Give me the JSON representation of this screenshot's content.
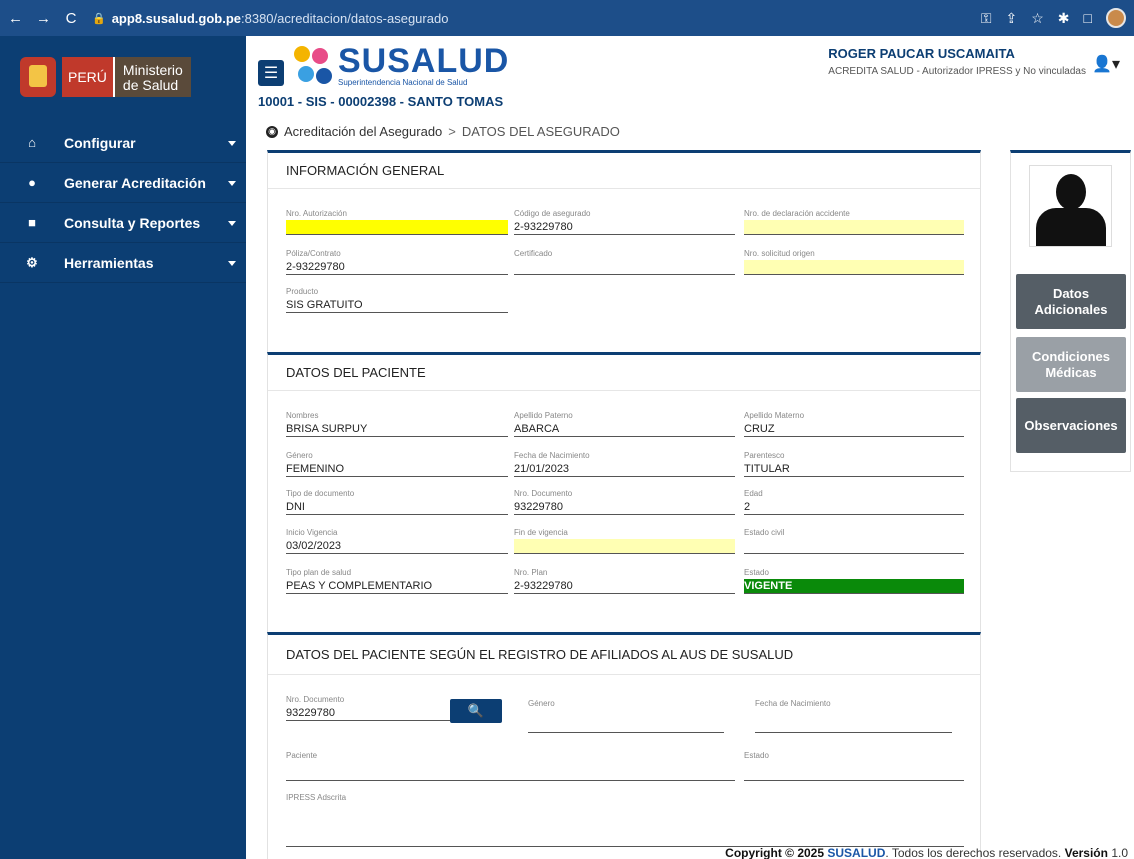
{
  "browser": {
    "url_domain": "app8.susalud.gob.pe",
    "url_path": ":8380/acreditacion/datos-asegurado"
  },
  "sidebar": {
    "logo_peru": "PERÚ",
    "logo_min_1": "Ministerio",
    "logo_min_2": "de Salud",
    "items": [
      {
        "label": "Configurar",
        "icon": "home-icon"
      },
      {
        "label": "Generar Acreditación",
        "icon": "user-icon"
      },
      {
        "label": "Consulta y Reportes",
        "icon": "report-icon"
      },
      {
        "label": "Herramientas",
        "icon": "gears-icon"
      }
    ]
  },
  "header": {
    "brand": "SUSALUD",
    "brand_sub": "Superintendencia Nacional de Salud",
    "ipress": "10001 - SIS - 00002398 - SANTO TOMAS",
    "user_name": "ROGER PAUCAR USCAMAITA",
    "user_role": "ACREDITA SALUD - Autorizador IPRESS y No vinculadas"
  },
  "breadcrumb": {
    "root": "Acreditación del Asegurado",
    "sep": ">",
    "current": "DATOS DEL ASEGURADO"
  },
  "general": {
    "title": "INFORMACIÓN GENERAL",
    "nro_autorizacion_label": "Nro. Autorización",
    "nro_autorizacion": "",
    "codigo_asegurado_label": "Código de asegurado",
    "codigo_asegurado": "2-93229780",
    "nro_declaracion_label": "Nro. de declaración accidente",
    "nro_declaracion": "",
    "poliza_label": "Póliza/Contrato",
    "poliza": "2-93229780",
    "certificado_label": "Certificado",
    "certificado": "",
    "nro_solicitud_label": "Nro. solicitud origen",
    "nro_solicitud": "",
    "producto_label": "Producto",
    "producto": "SIS GRATUITO"
  },
  "paciente": {
    "title": "DATOS DEL PACIENTE",
    "nombres_label": "Nombres",
    "nombres": "BRISA SURPUY",
    "ap_paterno_label": "Apellido Paterno",
    "ap_paterno": "ABARCA",
    "ap_materno_label": "Apellido Materno",
    "ap_materno": "CRUZ",
    "genero_label": "Género",
    "genero": "FEMENINO",
    "fecha_nac_label": "Fecha de Nacimiento",
    "fecha_nac": "21/01/2023",
    "parentesco_label": "Parentesco",
    "parentesco": "TITULAR",
    "tipo_doc_label": "Tipo de documento",
    "tipo_doc": "DNI",
    "nro_doc_label": "Nro. Documento",
    "nro_doc": "93229780",
    "edad_label": "Edad",
    "edad": "2",
    "inicio_vig_label": "Inicio Vigencia",
    "inicio_vig": "03/02/2023",
    "fin_vig_label": "Fin de vigencia",
    "fin_vig": "",
    "estado_civil_label": "Estado civil",
    "estado_civil": "",
    "tipo_plan_label": "Tipo plan de salud",
    "tipo_plan": "PEAS Y COMPLEMENTARIO",
    "nro_plan_label": "Nro. Plan",
    "nro_plan": "2-93229780",
    "estado_label": "Estado",
    "estado": "VIGENTE"
  },
  "aus": {
    "title": "DATOS DEL PACIENTE SEGÚN EL REGISTRO DE AFILIADOS AL AUS DE SUSALUD",
    "nro_doc_label": "Nro. Documento",
    "nro_doc": "93229780",
    "genero_label": "Género",
    "genero": "",
    "fecha_nac_label": "Fecha de Nacimiento",
    "fecha_nac": "",
    "paciente_label": "Paciente",
    "paciente": "",
    "estado_label": "Estado",
    "estado": "",
    "ipress_label": "IPRESS Adscrita",
    "ipress": ""
  },
  "right": {
    "btn_datos": "Datos Adicionales",
    "btn_condiciones": "Condiciones Médicas",
    "btn_obs": "Observaciones"
  },
  "footer": {
    "copy": "Copyright © 2025",
    "brand": "SUSALUD",
    "rights": ". Todos los derechos reservados.",
    "version_label": "Versión",
    "version": "1.0"
  }
}
